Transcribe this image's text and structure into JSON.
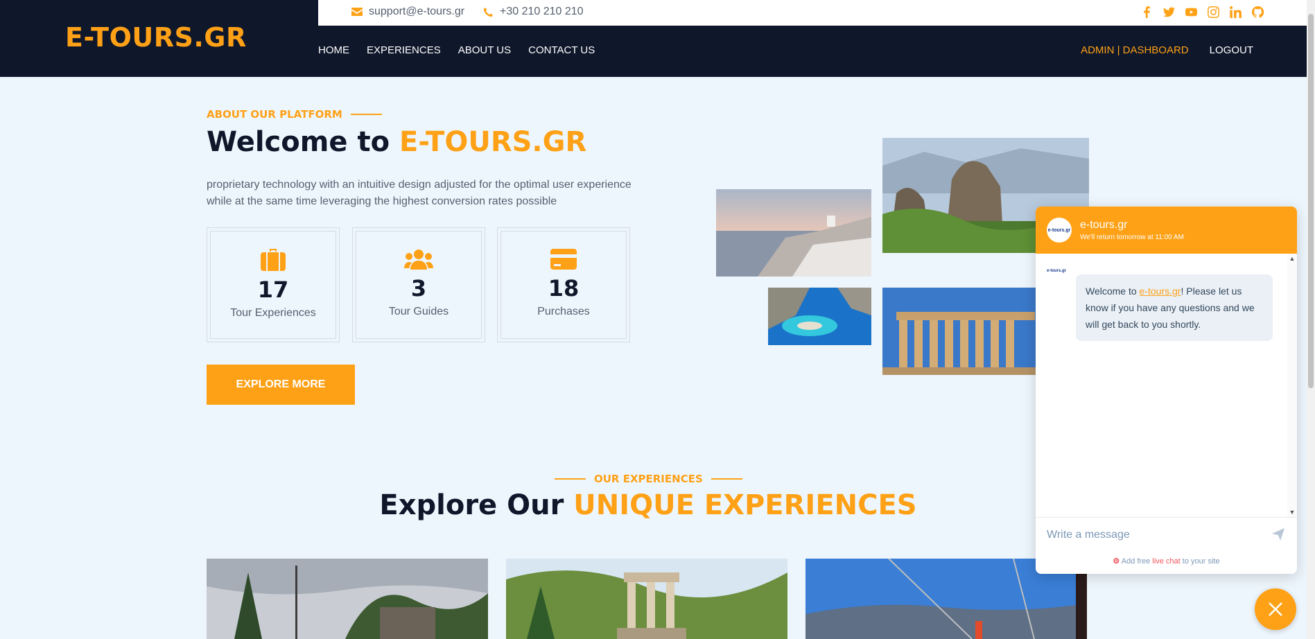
{
  "brand": {
    "logo": "E-TOURS.GR",
    "accent_color": "#fea116",
    "dark_color": "#0f172b"
  },
  "topbar": {
    "email": "support@e-tours.gr",
    "phone": "+30 210 210 210",
    "social_icons": [
      "facebook-icon",
      "twitter-icon",
      "youtube-icon",
      "instagram-icon",
      "linkedin-icon",
      "github-icon"
    ]
  },
  "nav": {
    "items": [
      {
        "label": "HOME"
      },
      {
        "label": "EXPERIENCES"
      },
      {
        "label": "ABOUT US"
      },
      {
        "label": "CONTACT US"
      }
    ],
    "admin": "ADMIN | DASHBOARD",
    "logout": "LOGOUT"
  },
  "about": {
    "eyebrow": "ABOUT OUR PLATFORM",
    "title_prefix": "Welcome to",
    "title_accent": "E-TOURS.GR",
    "text": "proprietary technology with an intuitive design adjusted for the optimal user experience while at the same time leveraging the highest conversion rates possible",
    "stats": [
      {
        "icon": "suitcase-icon",
        "number": "17",
        "label": "Tour Experiences"
      },
      {
        "icon": "users-icon",
        "number": "3",
        "label": "Tour Guides"
      },
      {
        "icon": "credit-card-icon",
        "number": "18",
        "label": "Purchases"
      }
    ],
    "button": "EXPLORE MORE",
    "images": [
      "santorini-image",
      "meteora-image",
      "navagio-image",
      "parthenon-image"
    ]
  },
  "experiences": {
    "eyebrow": "OUR EXPERIENCES",
    "title_prefix": "Explore Our",
    "title_accent": "UNIQUE EXPERIENCES",
    "cards": [
      "village-image",
      "delphi-image",
      "santorini-boat-image"
    ]
  },
  "chat": {
    "name": "e-tours.gr",
    "status": "We'll return tomorrow at 11:00 AM",
    "avatar_text": "e-tours.gr",
    "message_prefix": "Welcome to ",
    "message_link": "e-tours.gr",
    "message_suffix": "! Please let us know if you have any questions and we will get back to you shortly.",
    "input_placeholder": "Write a message",
    "footer_prefix": "Add free ",
    "footer_link": "live chat",
    "footer_suffix": " to your site"
  }
}
